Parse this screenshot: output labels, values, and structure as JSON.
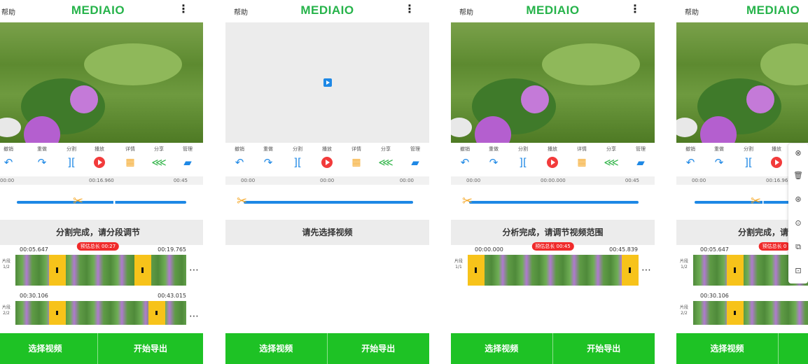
{
  "app": {
    "title": "MEDIAIO",
    "help_label": "帮助",
    "menu_icon": "more-vert-icon"
  },
  "colors": {
    "green": "#1ec225",
    "accent_blue": "#1e88e5",
    "handle_yellow": "#f7c31a",
    "tag_red": "#f02a2a"
  },
  "toolbar": {
    "items": [
      {
        "label": "撤销",
        "icon": "undo-icon",
        "glyph": "↶"
      },
      {
        "label": "重做",
        "icon": "redo-icon",
        "glyph": "↷"
      },
      {
        "label": "分割",
        "icon": "split-icon",
        "glyph": "]["
      },
      {
        "label": "播放",
        "icon": "play-icon",
        "glyph": ""
      },
      {
        "label": "详情",
        "icon": "grid-icon",
        "glyph": "▦"
      },
      {
        "label": "分享",
        "icon": "share-icon",
        "glyph": "⋘"
      },
      {
        "label": "管理",
        "icon": "folder-icon",
        "glyph": "▰"
      }
    ]
  },
  "screens": [
    {
      "time_start": "00:00",
      "time_mid": "00:16.960",
      "time_end": "00:45",
      "status": "分割完成，请分段调节",
      "segments": [
        {
          "label": "片段\n1/2",
          "start": "00:05.647",
          "end": "00:19.765",
          "tag": "预估总长 00:27"
        },
        {
          "label": "片段\n2/2",
          "start": "00:30.106",
          "end": "00:43.015"
        }
      ],
      "select_label": "选择视频",
      "export_label": "开始导出"
    },
    {
      "time_start": "00:00",
      "time_mid": "00:00",
      "time_end": "00:00",
      "status": "请先选择视频",
      "select_label": "选择视频",
      "export_label": "开始导出"
    },
    {
      "time_start": "00:00",
      "time_mid": "00:00.000",
      "time_end": "00:45",
      "status": "分析完成，请调节视频范围",
      "segments": [
        {
          "label": "片段\n1/1",
          "start": "00:00.000",
          "end": "00:45.839",
          "tag": "预估总长 00:45"
        }
      ],
      "select_label": "选择视频",
      "export_label": "开始导出"
    },
    {
      "time_start": "00:00",
      "time_mid": "00:16.96",
      "status": "分割完成，请",
      "segments": [
        {
          "label": "片段\n1/2",
          "start": "00:05.647",
          "tag": "预估总长 0"
        },
        {
          "label": "片段\n2/2",
          "start": "00:30.106"
        }
      ],
      "select_label": "选择视频",
      "side_menu": [
        "close-circle-icon",
        "delete-icon",
        "fast-forward-icon",
        "play-circle-icon",
        "skip-icon",
        "crop-icon"
      ]
    }
  ]
}
